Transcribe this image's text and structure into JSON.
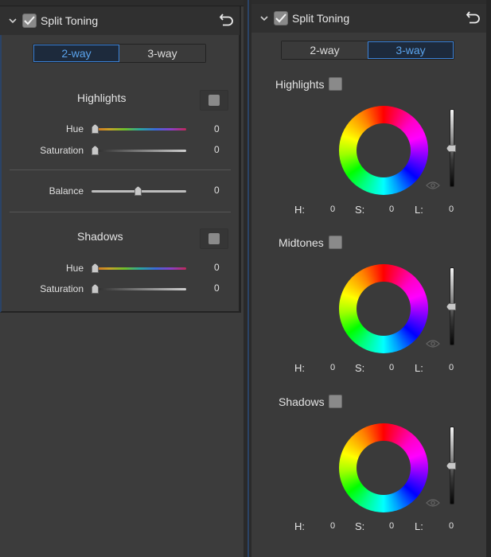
{
  "left_panel": {
    "title": "Split Toning",
    "enabled": true,
    "mode_tabs": [
      {
        "label": "2-way",
        "active": true
      },
      {
        "label": "3-way",
        "active": false
      }
    ],
    "highlights": {
      "title": "Highlights",
      "hue_label": "Hue",
      "hue_value": "0",
      "saturation_label": "Saturation",
      "saturation_value": "0"
    },
    "balance": {
      "label": "Balance",
      "value": "0"
    },
    "shadows": {
      "title": "Shadows",
      "hue_label": "Hue",
      "hue_value": "0",
      "saturation_label": "Saturation",
      "saturation_value": "0"
    }
  },
  "right_panel": {
    "title": "Split Toning",
    "enabled": true,
    "mode_tabs": [
      {
        "label": "2-way",
        "active": false
      },
      {
        "label": "3-way",
        "active": true
      }
    ],
    "sections": [
      {
        "title": "Highlights",
        "h_label": "H:",
        "h": "0",
        "s_label": "S:",
        "s": "0",
        "l_label": "L:",
        "l": "0",
        "luminance_level": 0.5
      },
      {
        "title": "Midtones",
        "h_label": "H:",
        "h": "0",
        "s_label": "S:",
        "s": "0",
        "l_label": "L:",
        "l": "0",
        "luminance_level": 0.5
      },
      {
        "title": "Shadows",
        "h_label": "H:",
        "h": "0",
        "s_label": "S:",
        "s": "0",
        "l_label": "L:",
        "l": "0",
        "luminance_level": 0.5
      }
    ]
  },
  "colors": {
    "accent": "#3b82d8",
    "accent_text": "#5aa3ec",
    "panel_bg": "#3a3a3a",
    "header_bg": "#303030"
  },
  "icons": {
    "collapse": "chevron-down-icon",
    "enable": "checkbox-checked-icon",
    "reset": "undo-icon",
    "preview": "eye-icon"
  }
}
